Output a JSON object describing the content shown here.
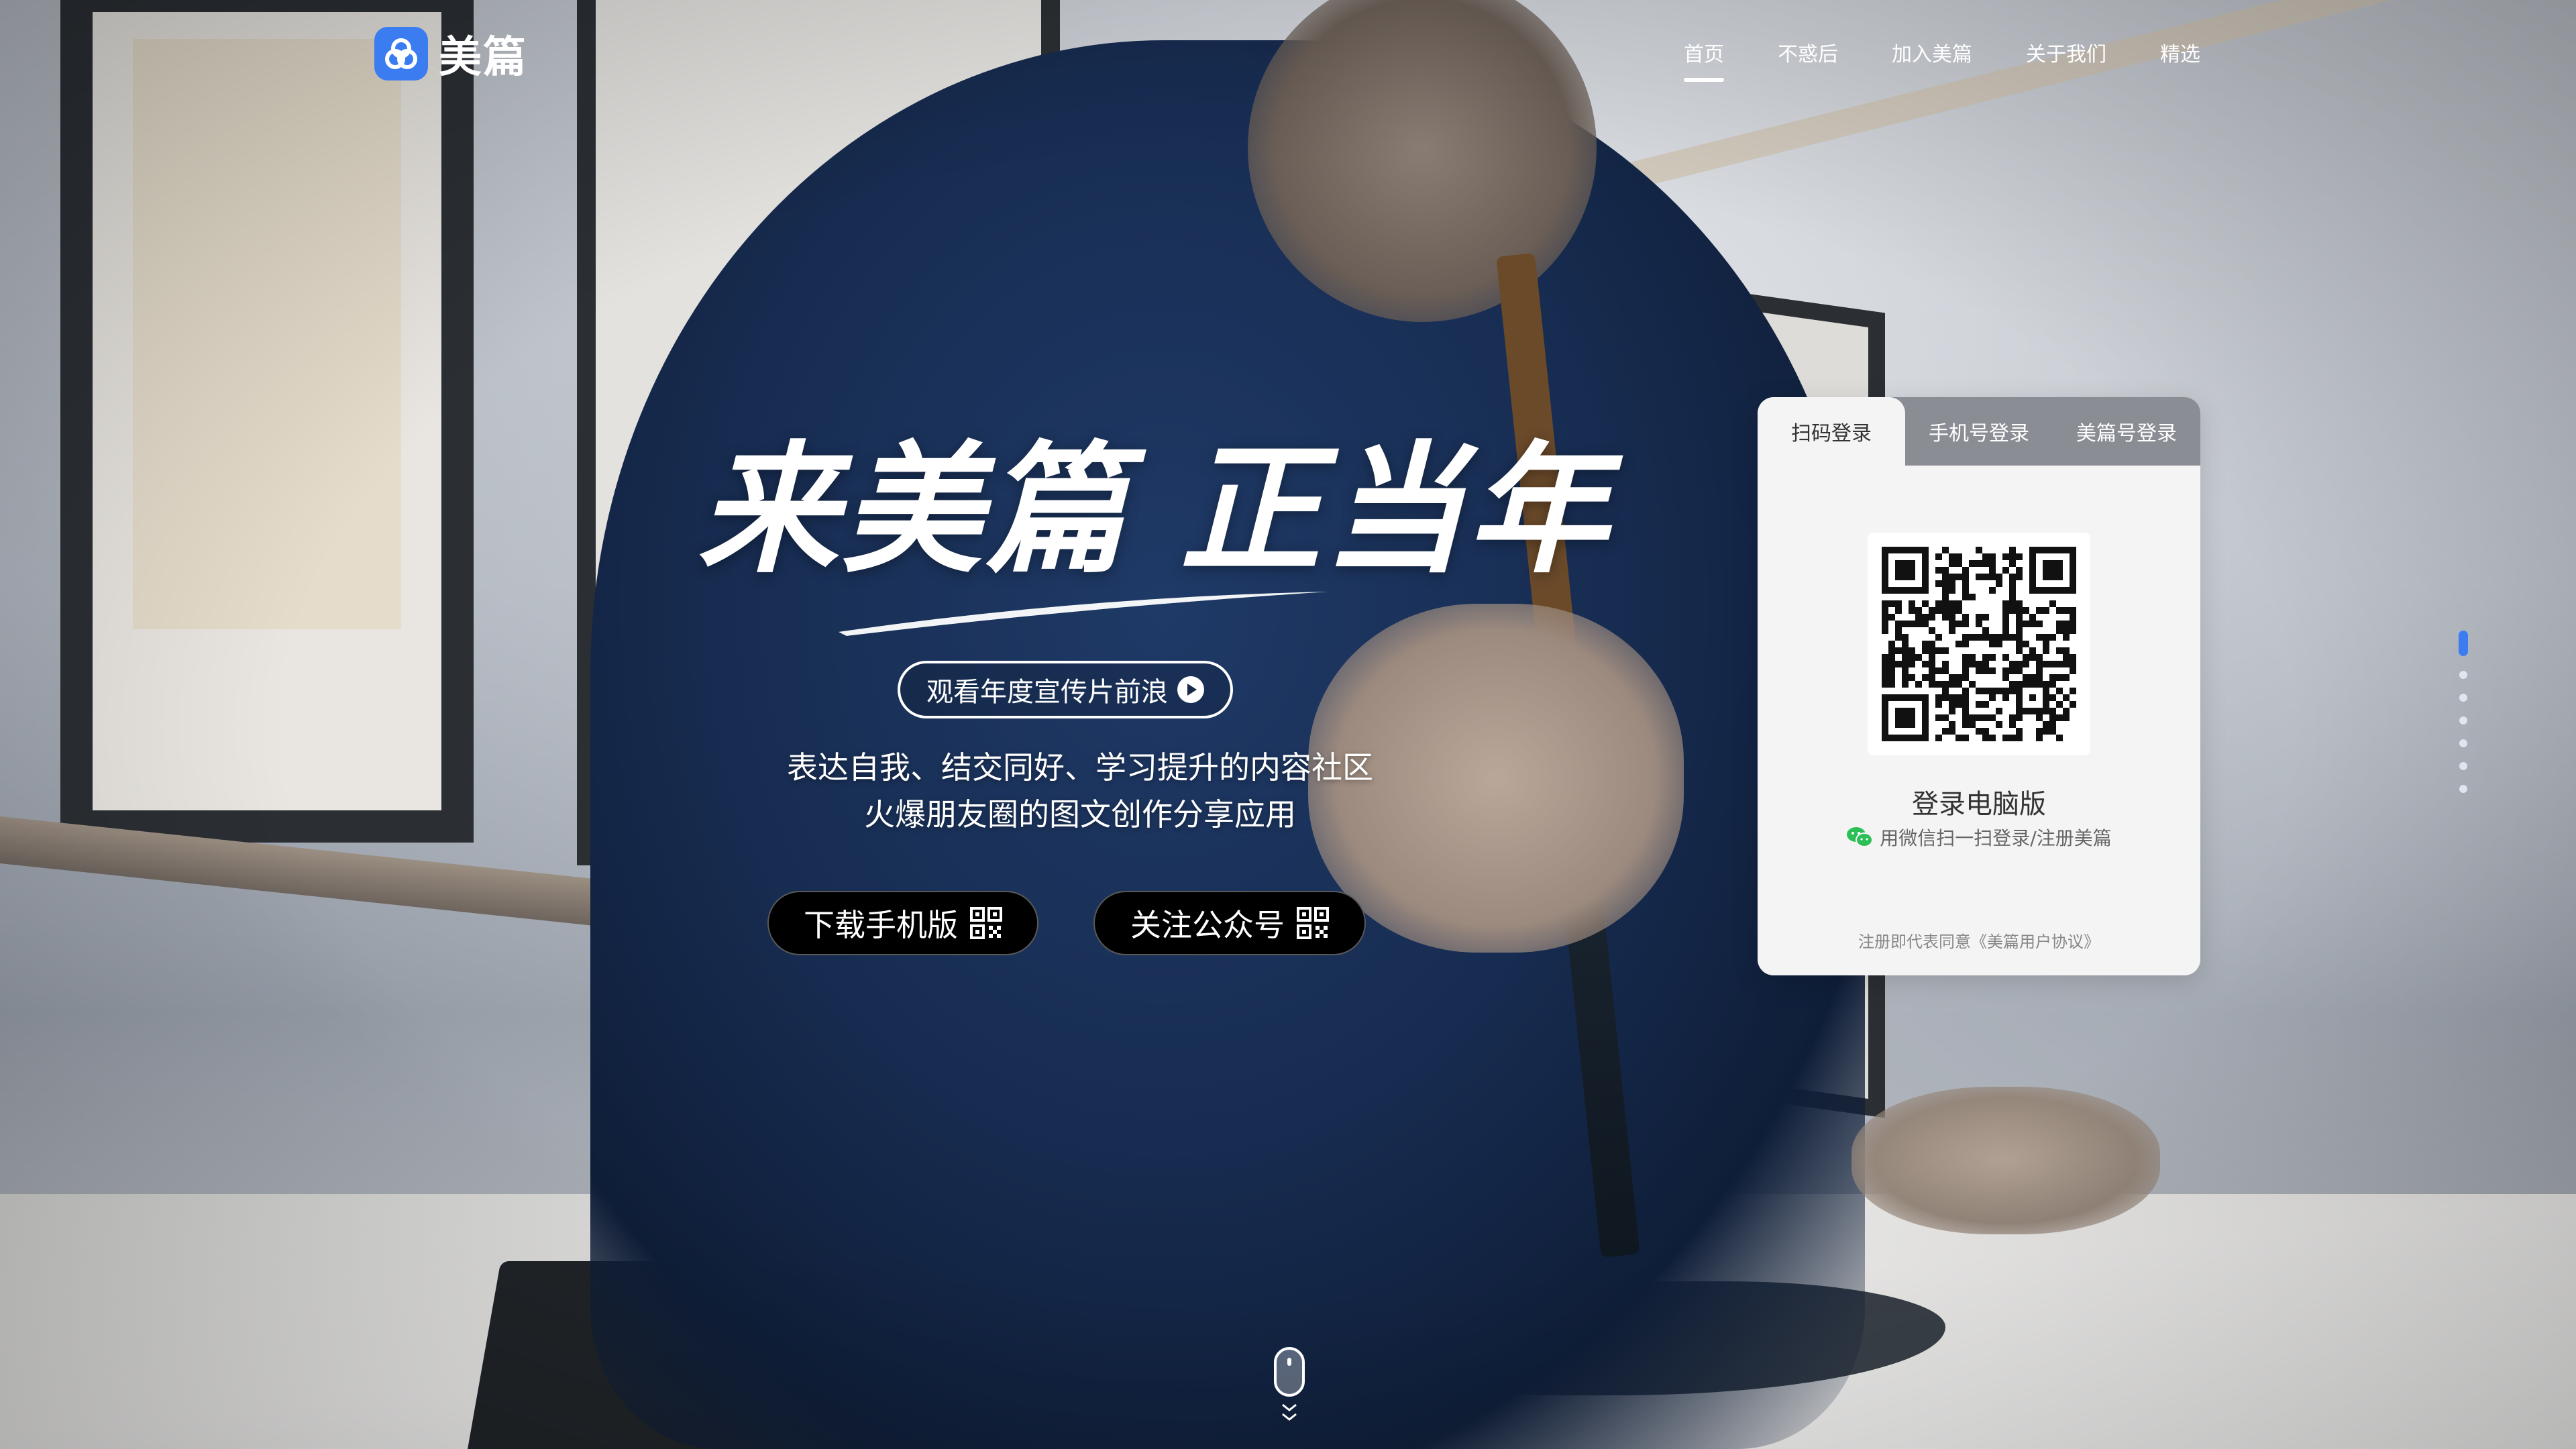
{
  "header": {
    "logo_text": "美篇",
    "nav": [
      {
        "label": "首页",
        "active": true
      },
      {
        "label": "不惑后",
        "active": false
      },
      {
        "label": "加入美篇",
        "active": false
      },
      {
        "label": "关于我们",
        "active": false
      },
      {
        "label": "精选",
        "active": false
      }
    ]
  },
  "hero": {
    "title": "来美篇 正当年",
    "video_button": "观看年度宣传片前浪",
    "tagline_line1": "表达自我、结交同好、学习提升的内容社区",
    "tagline_line2": "火爆朋友圈的图文创作分享应用",
    "download_button": "下载手机版",
    "follow_button": "关注公众号"
  },
  "login": {
    "tabs": [
      {
        "label": "扫码登录",
        "active": true
      },
      {
        "label": "手机号登录",
        "active": false
      },
      {
        "label": "美篇号登录",
        "active": false
      }
    ],
    "title": "登录电脑版",
    "subtitle": "用微信扫一扫登录/注册美篇",
    "agreement": "注册即代表同意《美篇用户协议》"
  },
  "pager": {
    "count": 7,
    "active_index": 0
  },
  "colors": {
    "brand": "#3b7df0",
    "wechat": "#2bbf56"
  },
  "icons": [
    "logo-icon",
    "play-icon",
    "qr-code-icon",
    "wechat-icon",
    "mouse-scroll-icon",
    "chevron-down-icon"
  ]
}
